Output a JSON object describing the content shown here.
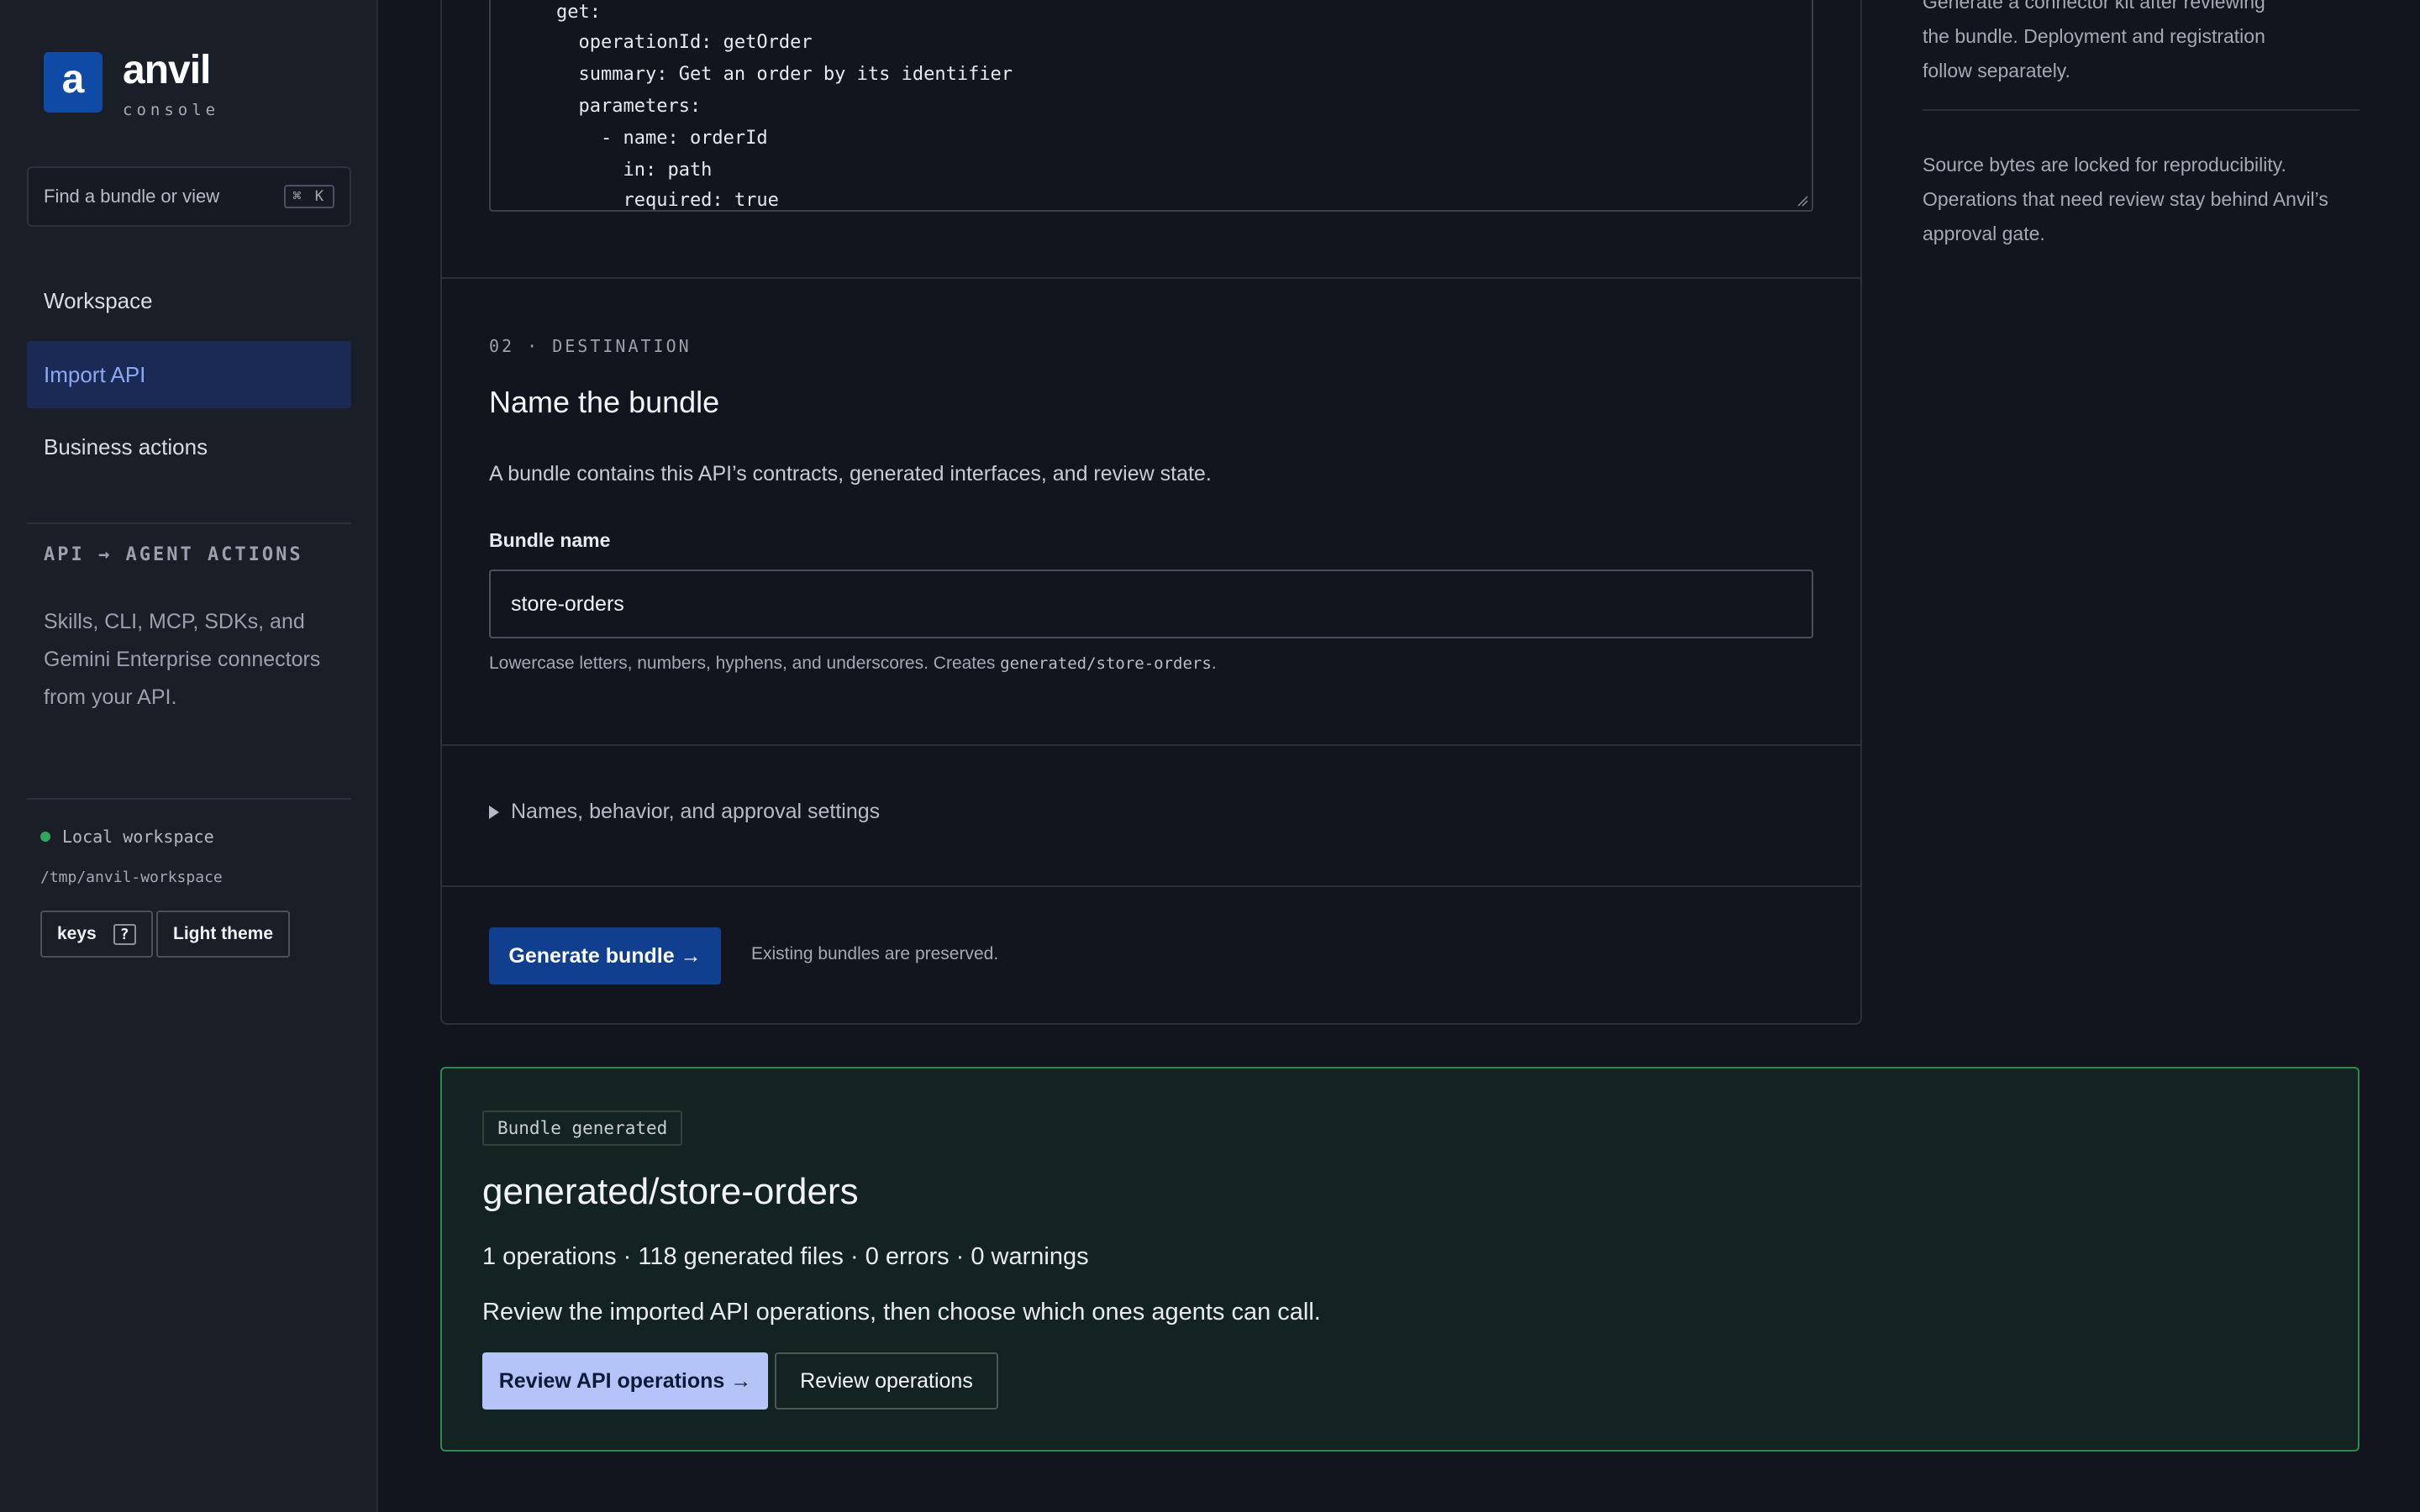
{
  "brand": {
    "logo_letter": "a",
    "name": "anvil",
    "subtitle": "console",
    "accent": "#0f4aa6"
  },
  "search": {
    "placeholder": "Find a bundle or view",
    "shortcut": "⌘ K"
  },
  "nav": {
    "items": [
      {
        "label": "Workspace",
        "active": false
      },
      {
        "label": "Import API",
        "active": true
      },
      {
        "label": "Business actions",
        "active": false
      }
    ]
  },
  "sidebar_section": {
    "label": "API → AGENT ACTIONS",
    "text": "Skills, CLI, MCP, SDKs, and Gemini Enterprise connectors from your API."
  },
  "workspace": {
    "status_label": "Local workspace",
    "status_color": "#2fa85c",
    "path": "/tmp/anvil-workspace",
    "keys_label": "keys",
    "keys_shortcut": "?",
    "theme_label": "Light theme"
  },
  "code_lines": [
    "get:",
    "  operationId: getOrder",
    "  summary: Get an order by its identifier",
    "  parameters:",
    "    - name: orderId",
    "      in: path",
    "      required: true"
  ],
  "destination": {
    "step_label": "02 · DESTINATION",
    "title": "Name the bundle",
    "description": "A bundle contains this API’s contracts, generated interfaces, and review state.",
    "field_label": "Bundle name",
    "field_value": "store-orders",
    "hint_prefix": "Lowercase letters, numbers, hyphens, and underscores. Creates ",
    "hint_path": "generated/store-orders",
    "hint_suffix": "."
  },
  "advanced": {
    "label": "Names, behavior, and approval settings"
  },
  "generate": {
    "button_label": "Generate bundle →",
    "note": "Existing bundles are preserved."
  },
  "right_column": {
    "text_1_lines": [
      "Generate a connector kit after reviewing",
      "the bundle. Deployment and registration",
      "follow separately."
    ],
    "text_2": "Source bytes are locked for reproducibility. Operations that need review stay behind Anvil’s approval gate."
  },
  "result": {
    "badge": "Bundle generated",
    "title": "generated/store-orders",
    "stats": "1 operations · 118 generated files · 0 errors · 0 warnings",
    "review_text": "Review the imported API operations, then choose which ones agents can call.",
    "primary_label": "Review API operations →",
    "secondary_label": "Review operations",
    "border_color": "#2a8a4f"
  }
}
